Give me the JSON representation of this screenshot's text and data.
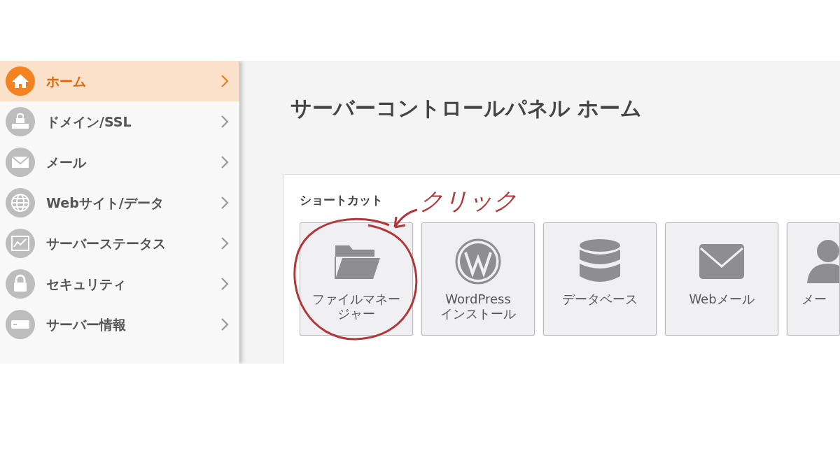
{
  "sidebar": {
    "items": [
      {
        "label": "ホーム",
        "kind": "home",
        "selected": true
      },
      {
        "label": "ドメイン/SSL",
        "kind": "domain",
        "selected": false
      },
      {
        "label": "メール",
        "kind": "mail",
        "selected": false
      },
      {
        "label": "Webサイト/データ",
        "kind": "globe",
        "selected": false
      },
      {
        "label": "サーバーステータス",
        "kind": "chart",
        "selected": false
      },
      {
        "label": "セキュリティ",
        "kind": "lock",
        "selected": false
      },
      {
        "label": "サーバー情報",
        "kind": "server",
        "selected": false
      }
    ]
  },
  "page_title": "サーバーコントロールパネル ホーム",
  "shortcuts": {
    "heading": "ショートカット",
    "items": [
      {
        "lines": [
          "ファイルマネー",
          "ジャー"
        ],
        "kind": "folder"
      },
      {
        "lines": [
          "WordPress",
          "インストール"
        ],
        "kind": "wordpress"
      },
      {
        "lines": [
          "データベース"
        ],
        "kind": "database"
      },
      {
        "lines": [
          "Webメール"
        ],
        "kind": "mail"
      },
      {
        "lines": [
          "メー"
        ],
        "kind": "person"
      }
    ]
  },
  "annotation": {
    "text": "クリック"
  }
}
